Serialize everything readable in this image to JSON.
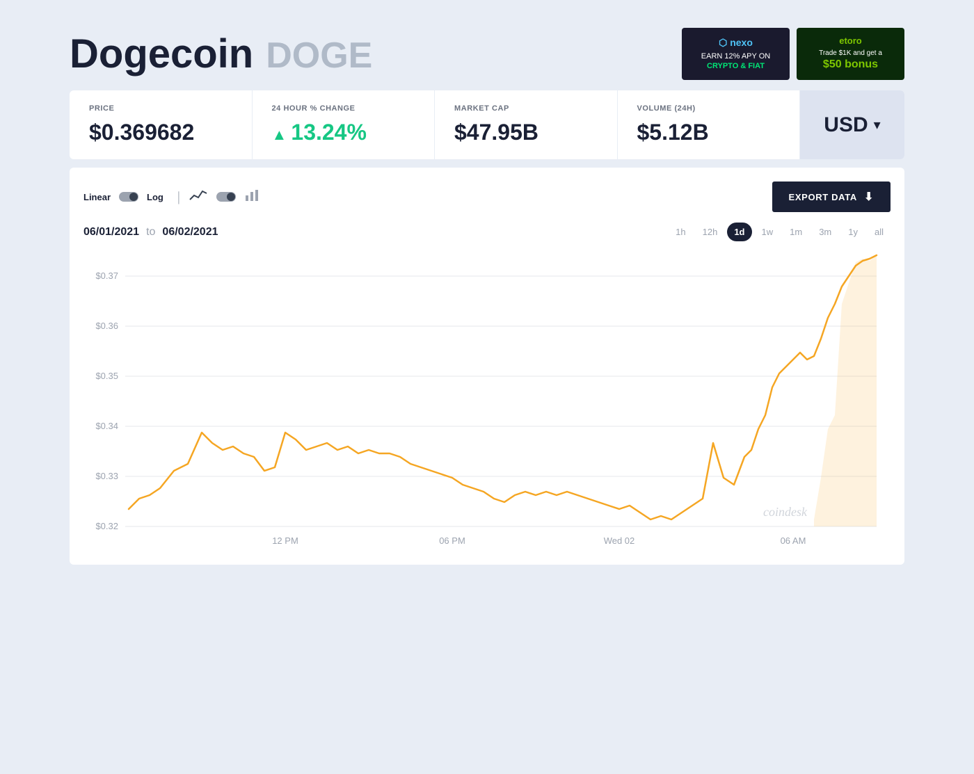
{
  "header": {
    "coin_name": "Dogecoin",
    "coin_symbol": "DOGE"
  },
  "ads": {
    "nexo": {
      "logo": "nexo",
      "line1": "EARN 12% APY ON",
      "line2": "CRYPTO & FIAT"
    },
    "etoro": {
      "logo": "etoro",
      "line1": "Trade $1K and get a",
      "line2": "$50 bonus"
    }
  },
  "stats": {
    "price_label": "PRICE",
    "price_value": "$0.369682",
    "change_label": "24 HOUR % CHANGE",
    "change_value": "13.24%",
    "marketcap_label": "MARKET CAP",
    "marketcap_value": "$47.95B",
    "volume_label": "VOLUME (24H)",
    "volume_value": "$5.12B",
    "currency": "USD"
  },
  "chart": {
    "chart_type_linear": "Linear",
    "chart_type_log": "Log",
    "export_label": "EXPORT DATA",
    "date_from": "06/01/2021",
    "date_to": "06/02/2021",
    "date_separator": "to",
    "time_ranges": [
      "1h",
      "12h",
      "1d",
      "1w",
      "1m",
      "3m",
      "1y",
      "all"
    ],
    "active_range": "1d",
    "x_labels": [
      "12 PM",
      "06 PM",
      "Wed 02",
      "06 AM"
    ],
    "y_labels": [
      "$0.37",
      "$0.36",
      "$0.35",
      "$0.34",
      "$0.33",
      "$0.32"
    ],
    "watermark": "coindesk"
  }
}
